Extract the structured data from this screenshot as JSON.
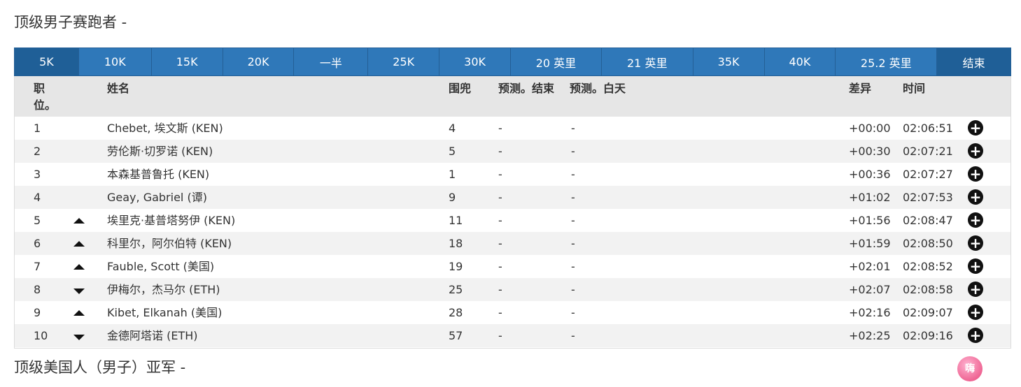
{
  "section1_title": "顶级男子赛跑者 -",
  "section2_title": "顶级美国人（男子）亚军 -",
  "tabs": [
    {
      "label": "5K",
      "width": 92
    },
    {
      "label": "10K",
      "width": 104
    },
    {
      "label": "15K",
      "width": 102
    },
    {
      "label": "20K",
      "width": 102
    },
    {
      "label": "一半",
      "width": 106
    },
    {
      "label": "25K",
      "width": 102
    },
    {
      "label": "30K",
      "width": 102
    },
    {
      "label": "20 英里",
      "width": 130
    },
    {
      "label": "21 英里",
      "width": 131
    },
    {
      "label": "35K",
      "width": 102
    },
    {
      "label": "40K",
      "width": 102
    },
    {
      "label": "25.2 英里",
      "width": 145
    },
    {
      "label": "结束",
      "width": 105
    }
  ],
  "active_tab": "5K",
  "columns": {
    "pos_line1": "职",
    "pos_line2": "位。",
    "name": "姓名",
    "bib": "围兜",
    "proj_finish": "预测。结束",
    "proj_day": "预测。白天",
    "diff": "差异",
    "time": "时间"
  },
  "rows": [
    {
      "pos": "1",
      "trend": "",
      "name": "Chebet, 埃文斯 (KEN)",
      "bib": "4",
      "pf": "-",
      "pd": "-",
      "diff": "+00:00",
      "time": "02:06:51"
    },
    {
      "pos": "2",
      "trend": "",
      "name": "劳伦斯·切罗诺 (KEN)",
      "bib": "5",
      "pf": "-",
      "pd": "-",
      "diff": "+00:30",
      "time": "02:07:21"
    },
    {
      "pos": "3",
      "trend": "",
      "name": "本森基普鲁托 (KEN)",
      "bib": "1",
      "pf": "-",
      "pd": "-",
      "diff": "+00:36",
      "time": "02:07:27"
    },
    {
      "pos": "4",
      "trend": "",
      "name": "Geay, Gabriel (谭)",
      "bib": "9",
      "pf": "-",
      "pd": "-",
      "diff": "+01:02",
      "time": "02:07:53"
    },
    {
      "pos": "5",
      "trend": "up",
      "name": "埃里克·基普塔努伊 (KEN)",
      "bib": "11",
      "pf": "-",
      "pd": "-",
      "diff": "+01:56",
      "time": "02:08:47"
    },
    {
      "pos": "6",
      "trend": "up",
      "name": "科里尔，阿尔伯特 (KEN)",
      "bib": "18",
      "pf": "-",
      "pd": "-",
      "diff": "+01:59",
      "time": "02:08:50"
    },
    {
      "pos": "7",
      "trend": "up",
      "name": "Fauble, Scott (美国)",
      "bib": "19",
      "pf": "-",
      "pd": "-",
      "diff": "+02:01",
      "time": "02:08:52"
    },
    {
      "pos": "8",
      "trend": "down",
      "name": "伊梅尔，杰马尔 (ETH)",
      "bib": "25",
      "pf": "-",
      "pd": "-",
      "diff": "+02:07",
      "time": "02:08:58"
    },
    {
      "pos": "9",
      "trend": "up",
      "name": "Kibet, Elkanah (美国)",
      "bib": "28",
      "pf": "-",
      "pd": "-",
      "diff": "+02:16",
      "time": "02:09:07"
    },
    {
      "pos": "10",
      "trend": "down",
      "name": "金德阿塔诺 (ETH)",
      "bib": "57",
      "pf": "-",
      "pd": "-",
      "diff": "+02:25",
      "time": "02:09:16"
    }
  ],
  "logo_text": "嗨"
}
